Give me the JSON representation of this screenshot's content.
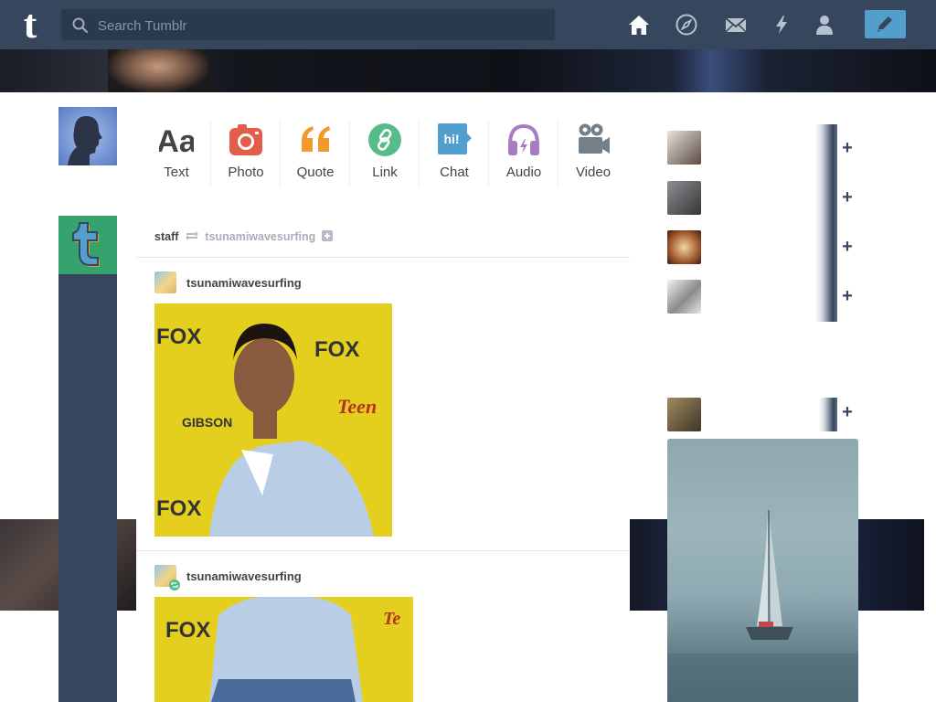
{
  "nav": {
    "logo": "t",
    "search_placeholder": "Search Tumblr",
    "icons": [
      "home-icon",
      "explore-icon",
      "inbox-icon",
      "activity-icon",
      "account-icon",
      "compose-icon"
    ]
  },
  "post_types": [
    {
      "label": "Text",
      "icon": "text-icon",
      "color": "#444444"
    },
    {
      "label": "Photo",
      "icon": "camera-icon",
      "color": "#e25e4a"
    },
    {
      "label": "Quote",
      "icon": "quote-icon",
      "color": "#f2992e"
    },
    {
      "label": "Link",
      "icon": "link-icon",
      "color": "#56bc8a"
    },
    {
      "label": "Chat",
      "icon": "chat-icon",
      "color": "#529ecc"
    },
    {
      "label": "Audio",
      "icon": "headphones-icon",
      "color": "#a77dc2"
    },
    {
      "label": "Video",
      "icon": "video-camera-icon",
      "color": "#748089"
    }
  ],
  "feed": {
    "reblog_from": "staff",
    "reblog_source": "tsunamiwavesurfing",
    "posts": [
      {
        "user": "tsunamiwavesurfing"
      },
      {
        "user": "tsunamiwavesurfing"
      }
    ]
  },
  "colors": {
    "nav_bg": "#36465d",
    "accent": "#529ecc",
    "staff_green": "#36a36e"
  }
}
